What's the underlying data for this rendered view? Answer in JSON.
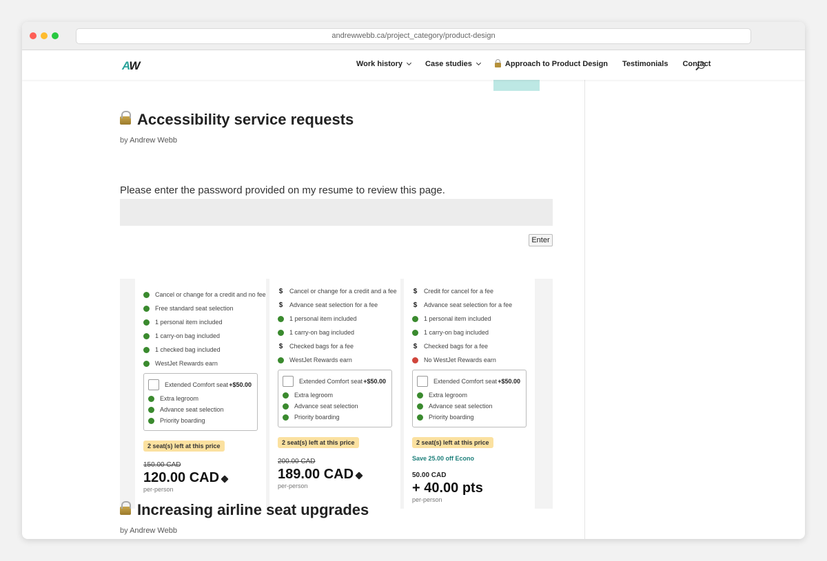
{
  "browser": {
    "url": "andrewwebb.ca/project_category/product-design"
  },
  "header": {
    "logo_left": "A",
    "logo_right": "W",
    "nav": [
      {
        "label": "Work history"
      },
      {
        "label": "Case studies"
      },
      {
        "label": "Approach to Product Design"
      },
      {
        "label": "Testimonials"
      },
      {
        "label": "Contact"
      }
    ]
  },
  "posts": [
    {
      "title": "Accessibility service requests",
      "byline_prefix": "by",
      "author": "Andrew Webb"
    },
    {
      "title": "Increasing airline seat upgrades",
      "byline_prefix": "by",
      "author": "Andrew Webb"
    }
  ],
  "password": {
    "prompt": "Please enter the password provided on my resume to review this page.",
    "button_label": "Enter"
  },
  "fares": [
    {
      "features": [
        {
          "icon": "check",
          "text": "Cancel or change for a credit and no fee"
        },
        {
          "icon": "check",
          "text": "Free standard seat selection"
        },
        {
          "icon": "check",
          "text": "1 personal item included"
        },
        {
          "icon": "check",
          "text": "1 carry-on bag included"
        },
        {
          "icon": "check",
          "text": "1 checked bag included"
        },
        {
          "icon": "check",
          "text": "WestJet Rewards earn"
        }
      ],
      "addon": {
        "title": "Extended Comfort seat",
        "price": "+$50.00",
        "items": [
          "Extra legroom",
          "Advance seat selection",
          "Priority boarding"
        ]
      },
      "badge": "2 seat(s) left at this price",
      "old_price": "150.00 CAD",
      "price": "120.00 CAD",
      "per": "per-person"
    },
    {
      "features": [
        {
          "icon": "dollar",
          "text": "Cancel or change for a credit and a fee"
        },
        {
          "icon": "dollar",
          "text": "Advance seat selection for a fee"
        },
        {
          "icon": "check",
          "text": "1 personal item included"
        },
        {
          "icon": "check",
          "text": "1 carry-on bag included"
        },
        {
          "icon": "dollar",
          "text": "Checked bags for a fee"
        },
        {
          "icon": "check",
          "text": "WestJet Rewards earn"
        }
      ],
      "addon": {
        "title": "Extended Comfort seat",
        "price": "+$50.00",
        "items": [
          "Extra legroom",
          "Advance seat selection",
          "Priority boarding"
        ]
      },
      "badge": "2 seat(s) left at this price",
      "old_price": "200.00 CAD",
      "price": "189.00 CAD",
      "per": "per-person"
    },
    {
      "features": [
        {
          "icon": "dollar",
          "text": "Credit for cancel for a fee"
        },
        {
          "icon": "dollar",
          "text": "Advance seat selection for a fee"
        },
        {
          "icon": "check",
          "text": "1 personal item included"
        },
        {
          "icon": "check",
          "text": "1 carry-on bag included"
        },
        {
          "icon": "dollar",
          "text": "Checked bags for a fee"
        },
        {
          "icon": "cross",
          "text": "No WestJet Rewards earn"
        }
      ],
      "addon": {
        "title": "Extended Comfort seat",
        "price": "+$50.00",
        "items": [
          "Extra legroom",
          "Advance seat selection",
          "Priority boarding"
        ]
      },
      "badge": "2 seat(s) left at this price",
      "save": "Save 25.00 off Econo",
      "old_price": "50.00 CAD",
      "price": "+ 40.00 pts",
      "per": "per-person"
    }
  ],
  "colors": {
    "accent": "#2aa39a",
    "badge": "#fbe1a0",
    "check": "#3a8a2e",
    "cross": "#d0453b"
  }
}
